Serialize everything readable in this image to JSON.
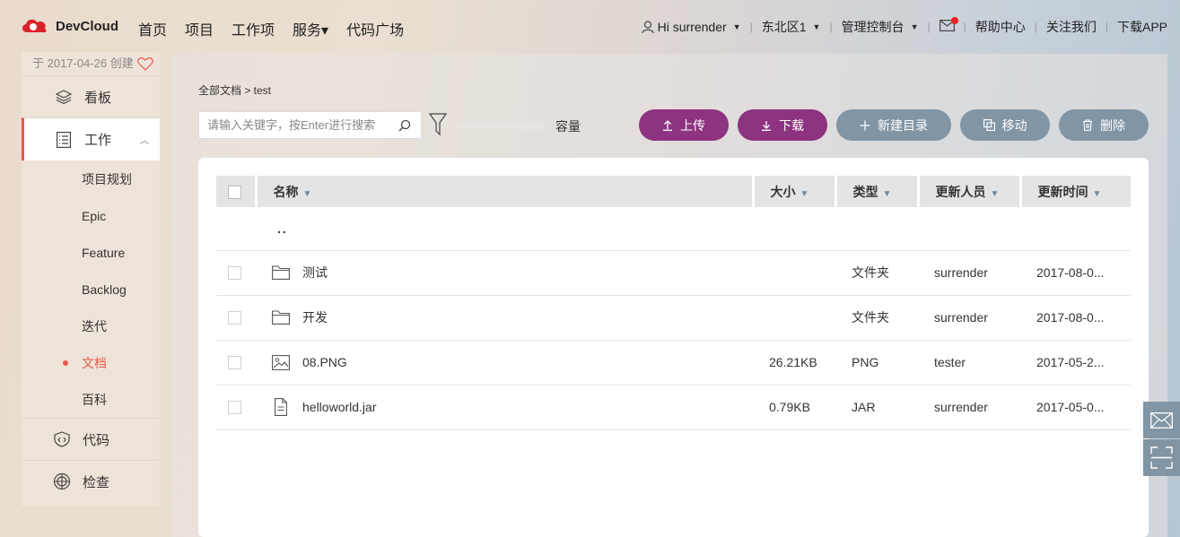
{
  "header": {
    "logo_text": "DevCloud",
    "nav": [
      "首页",
      "项目",
      "工作项",
      "服务▾",
      "代码广场"
    ],
    "user": "Hi surrender",
    "region": "东北区1",
    "console": "管理控制台",
    "help": "帮助中心",
    "follow": "关注我们",
    "download_app": "下载APP"
  },
  "sidebar": {
    "created": "于 2017-04-26 创建",
    "board": "看板",
    "work": "工作",
    "sub_items": [
      "项目规划",
      "Epic",
      "Feature",
      "Backlog",
      "迭代",
      "文档",
      "百科"
    ],
    "current_sub": "文档",
    "code": "代码",
    "inspect": "检查"
  },
  "breadcrumb": "全部文档  > test",
  "search": {
    "placeholder": "请输入关键字，按Enter进行搜索"
  },
  "capacity_label": "容量",
  "buttons": {
    "upload": "上传",
    "download": "下载",
    "new_dir": "新建目录",
    "move": "移动",
    "delete": "删除"
  },
  "table": {
    "headers": [
      "名称",
      "大小",
      "类型",
      "更新人员",
      "更新时间"
    ],
    "parent_dir": "..",
    "rows": [
      {
        "icon": "folder-icon",
        "name": "测试",
        "size": "",
        "type": "文件夹",
        "updater": "surrender",
        "time": "2017-08-0..."
      },
      {
        "icon": "folder-icon",
        "name": "开发",
        "size": "",
        "type": "文件夹",
        "updater": "surrender",
        "time": "2017-08-0..."
      },
      {
        "icon": "image-icon",
        "name": "08.PNG",
        "size": "26.21KB",
        "type": "PNG",
        "updater": "tester",
        "time": "2017-05-2..."
      },
      {
        "icon": "file-icon",
        "name": "helloworld.jar",
        "size": "0.79KB",
        "type": "JAR",
        "updater": "surrender",
        "time": "2017-05-0..."
      }
    ]
  },
  "colors": {
    "accent": "#8d3380",
    "grey_button": "#8195a5",
    "active": "#e8584a"
  }
}
